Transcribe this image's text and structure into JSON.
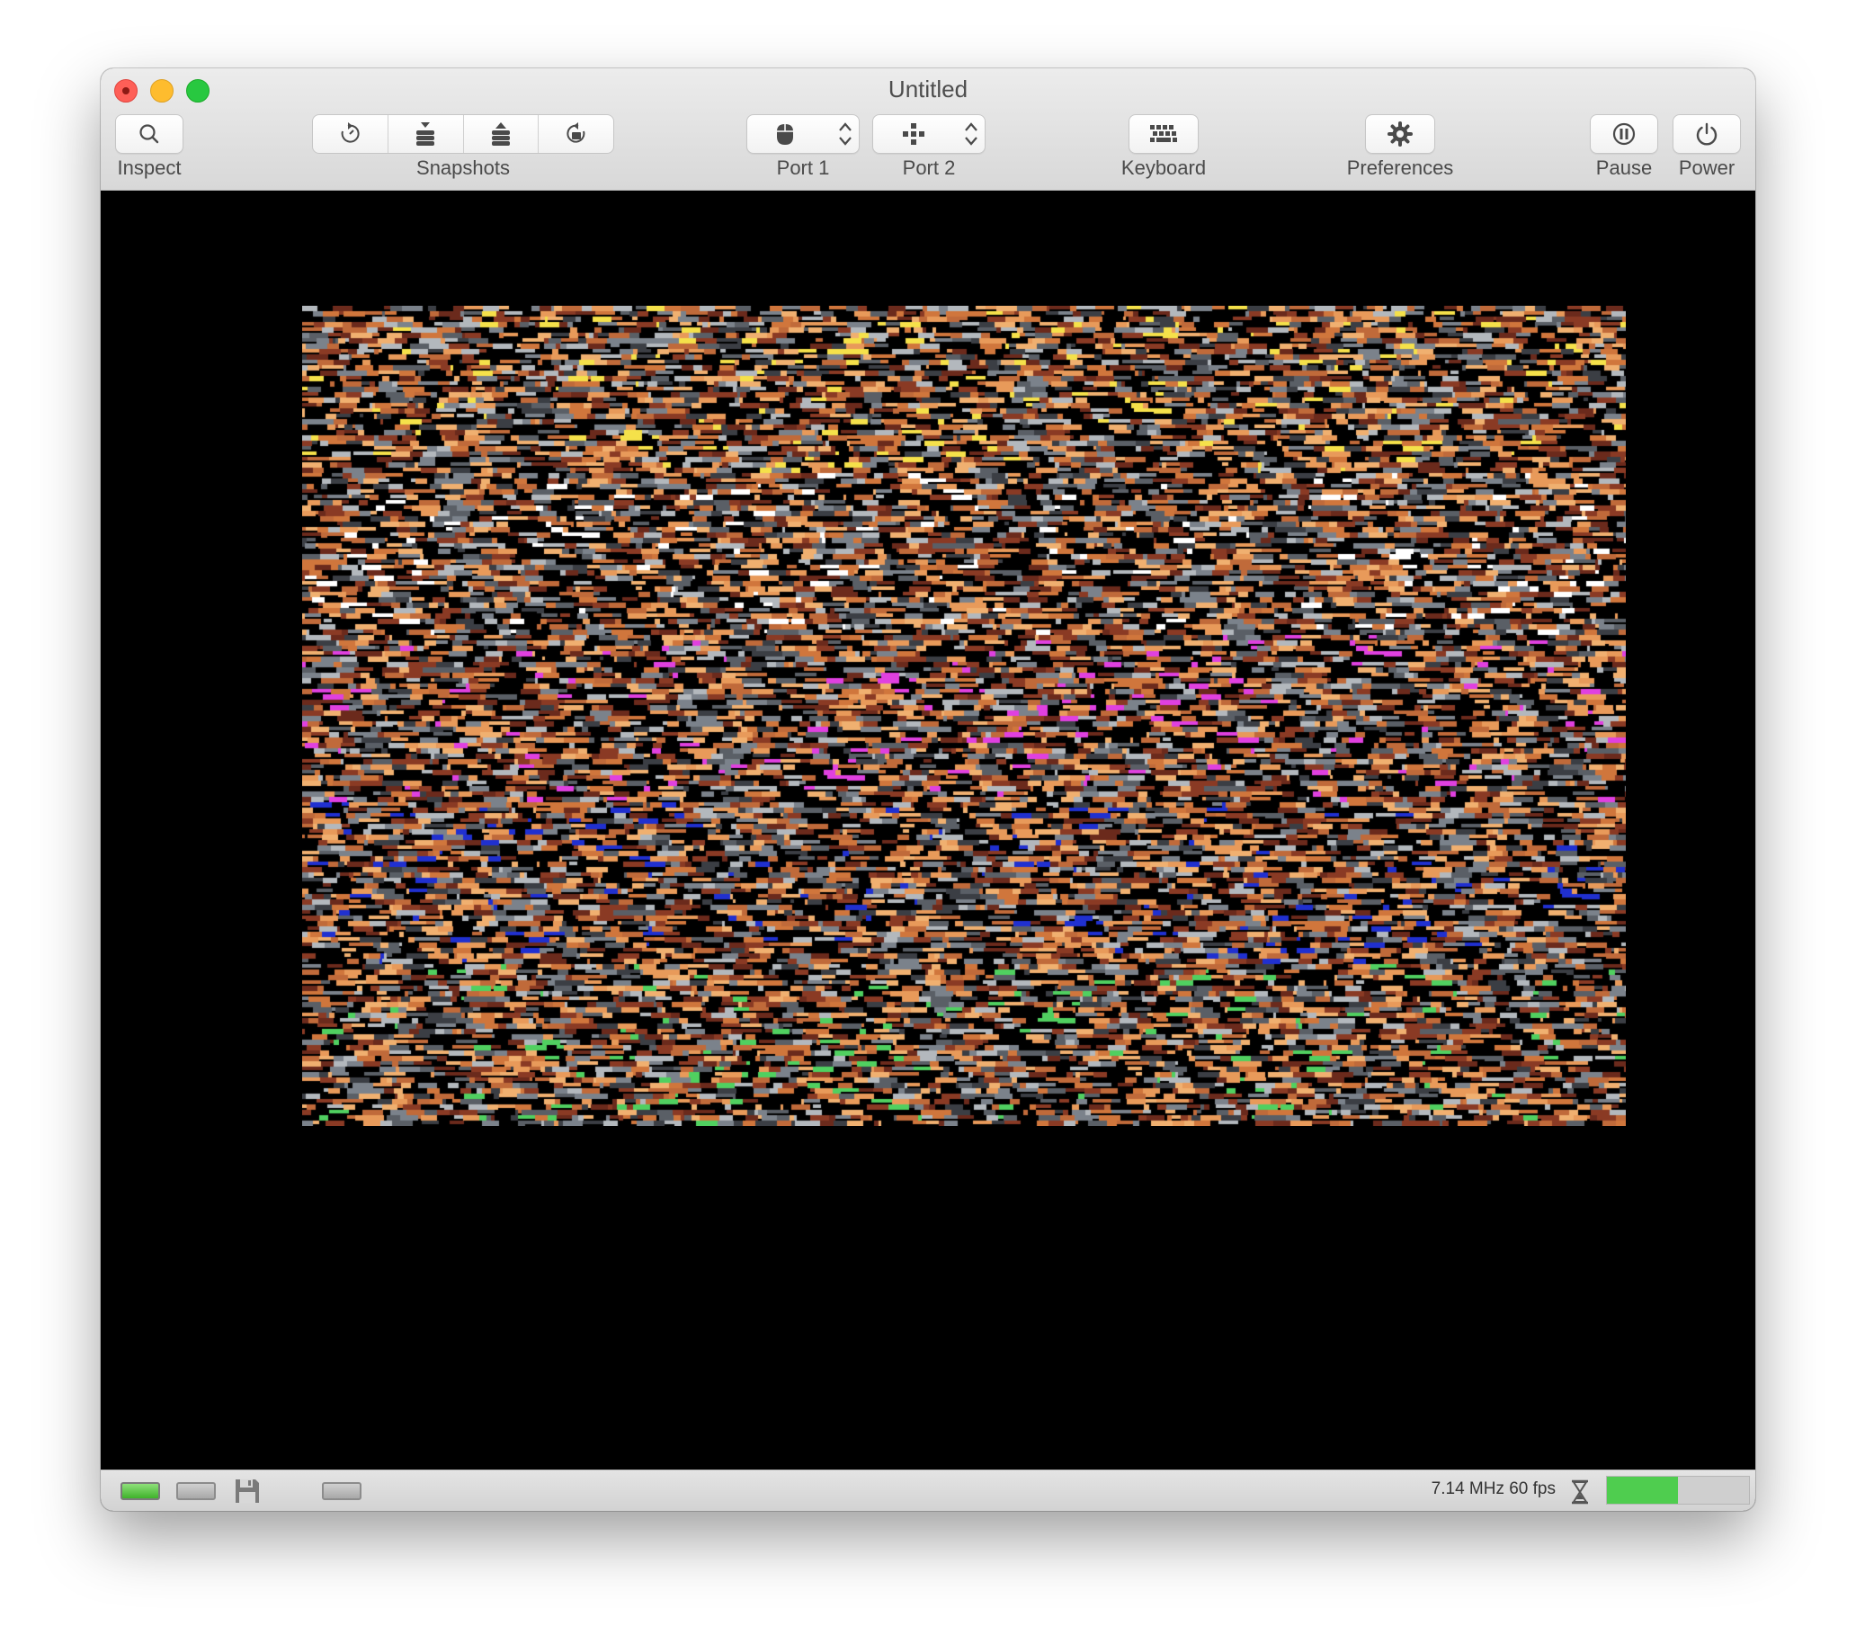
{
  "window": {
    "title": "Untitled"
  },
  "toolbar": {
    "inspect_label": "Inspect",
    "snapshots_label": "Snapshots",
    "port1_label": "Port 1",
    "port2_label": "Port 2",
    "keyboard_label": "Keyboard",
    "preferences_label": "Preferences",
    "pause_label": "Pause",
    "power_label": "Power",
    "icons": [
      "search-icon",
      "revert-icon",
      "take-snapshot-icon",
      "restore-snapshot-icon",
      "browse-snapshots-icon",
      "mouse-icon",
      "joystick-icon",
      "keyboard-icon",
      "gear-icon",
      "pause-icon",
      "power-icon"
    ]
  },
  "statusbar": {
    "status_text": "7.14 MHz 60 fps",
    "speed_fraction": 0.5,
    "icons": [
      "drive-1-icon",
      "drive-2-icon",
      "floppy-disk-icon",
      "cartridge-icon",
      "hourglass-icon"
    ]
  },
  "colors": {
    "accent_green": "#4fcd4f",
    "screen_background": "#000000"
  }
}
